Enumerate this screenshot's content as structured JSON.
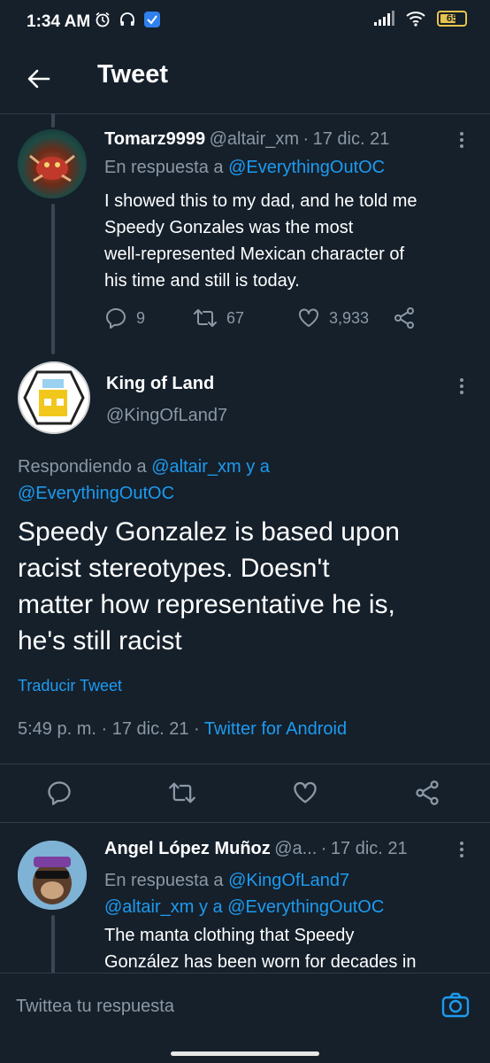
{
  "status_bar": {
    "time": "1:34 AM",
    "battery": "65",
    "battery_level": 0.65
  },
  "header": {
    "title": "Tweet"
  },
  "tweet1": {
    "display_name": "Tomarz9999",
    "handle": "@altair_xm",
    "separator": "·",
    "date": "17 dic. 21",
    "reply_prefix": "En respuesta a",
    "reply_to": "@EverythingOutOC",
    "text_lines": [
      "I showed this to my dad, and he told me",
      "Speedy Gonzales was the most",
      "well-represented Mexican character of",
      "his time and still is today."
    ],
    "replies": "9",
    "retweets": "67",
    "likes": "3,933"
  },
  "main_tweet": {
    "display_name": "King of Land",
    "handle": "@KingOfLand7",
    "reply_prefix": "Respondiendo a",
    "reply_to_1": "@altair_xm",
    "reply_joiner": "y a",
    "reply_to_2": "@EverythingOutOC",
    "text_lines": [
      "Speedy Gonzalez is based upon",
      "racist stereotypes. Doesn't",
      "matter how representative he is,",
      "he's still racist"
    ],
    "translate": "Traducir Tweet",
    "time": "5:49 p. m.",
    "sep": "·",
    "date": "17 dic. 21",
    "source": "Twitter for Android"
  },
  "tweet3": {
    "display_name": "Angel López Muñoz",
    "handle": "@a...",
    "separator": "·",
    "date": "17 dic. 21",
    "reply_prefix": "En respuesta a",
    "reply_to_1": "@KingOfLand7",
    "reply_to_2": "@altair_xm",
    "reply_joiner": "y a",
    "reply_to_3": "@EverythingOutOC",
    "text_lines": [
      "The manta clothing that Speedy",
      "González has been worn for decades in"
    ]
  },
  "reply_bar": {
    "placeholder": "Twittea tu respuesta"
  },
  "colors": {
    "background": "#15202b",
    "accent": "#1d9bf0",
    "muted": "#8b98a5",
    "divider": "#2f3b47"
  }
}
